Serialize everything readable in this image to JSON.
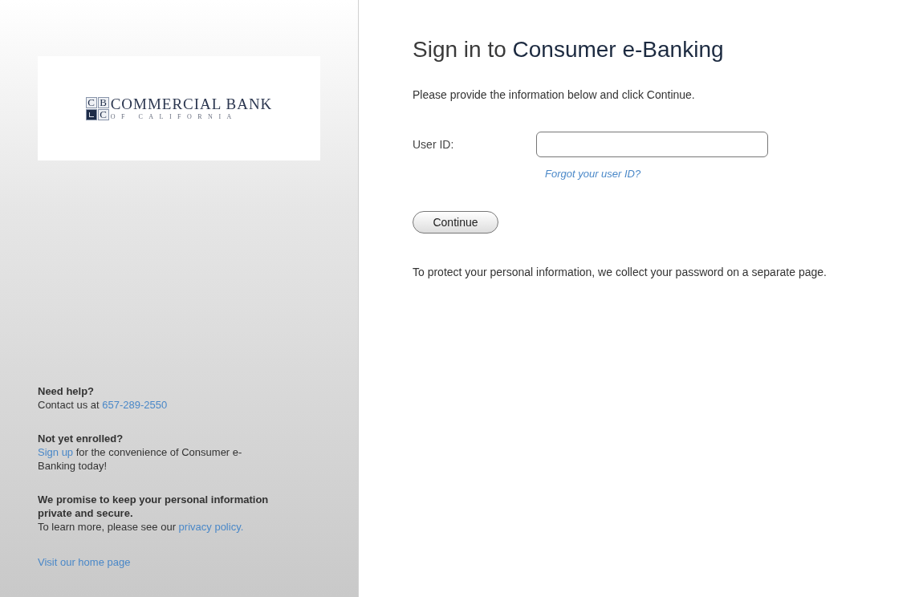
{
  "sidebar": {
    "logo": {
      "monogram": [
        {
          "letter": "C",
          "kind": "letter"
        },
        {
          "letter": "B",
          "kind": "letter"
        },
        {
          "kind": "mark"
        },
        {
          "letter": "C",
          "kind": "letter"
        }
      ],
      "name": "COMMERCIAL BANK",
      "tagline": "OF CALIFORNIA"
    },
    "sections": [
      {
        "heading": "Need help?",
        "body": [
          {
            "kind": "text",
            "text": "Contact us at "
          },
          {
            "kind": "link",
            "text": "657-289-2550"
          }
        ]
      },
      {
        "heading": "Not yet enrolled?",
        "body": [
          {
            "kind": "link",
            "text": "Sign up"
          },
          {
            "kind": "text",
            "text": " for the convenience of Consumer e-Banking today!"
          }
        ]
      },
      {
        "heading": "We promise to keep your personal information private and secure.",
        "body": [
          {
            "kind": "text",
            "text": "To learn more, please see our "
          },
          {
            "kind": "link",
            "text": "privacy policy."
          }
        ]
      }
    ],
    "home_link": "Visit our home page"
  },
  "main": {
    "title": {
      "lead": "Sign in to ",
      "product": "Consumer e-Banking"
    },
    "instructions": "Please provide the information below and click Continue.",
    "user_id": {
      "label": "User ID:",
      "forgot_link": "Forgot your user ID?"
    },
    "continue_button": "Continue",
    "note": "To protect your personal information, we collect your password on a separate page."
  }
}
